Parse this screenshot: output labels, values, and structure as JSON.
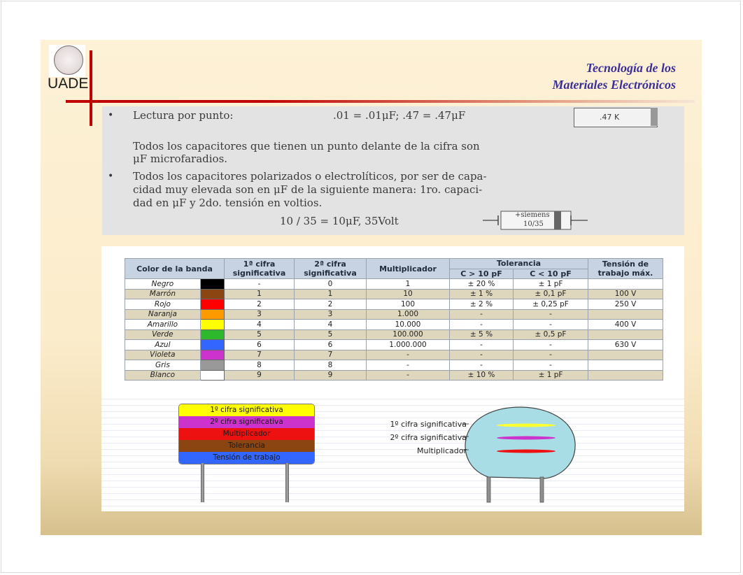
{
  "logo": {
    "text": "UADE"
  },
  "title": {
    "line1": "Tecnología de los",
    "line2": "Materiales Electrónicos"
  },
  "scan": {
    "bullet": "•",
    "lectura_label": "Lectura por punto:",
    "lectura_values": ".01 = .01μF;  .47 = .47μF",
    "cap_label": ".47 K",
    "para1_line1": "Todos los capacitores que tienen un punto delante de la cifra son",
    "para1_line2": "μF microfaradios.",
    "para2_line1": "Todos los capacitores polarizados o electrolíticos, por ser de capa-",
    "para2_line2": "cidad muy elevada son en μF de la siguiente manera: 1ro. capaci-",
    "para2_line3": "dad en μF  y 2do. tensión en voltios.",
    "example": "10 / 35  =  10μF, 35Volt",
    "elec_line1": "+siemens",
    "elec_line2": "10/35"
  },
  "table": {
    "headers": {
      "color": "Color de la banda",
      "cifra1": "1ª cifra significativa",
      "cifra2": "2ª cifra significativa",
      "mult": "Multiplicador",
      "tol": "Tolerancia",
      "tol_gt": "C > 10 pF",
      "tol_lt": "C < 10 pF",
      "tension": "Tensión de trabajo máx."
    },
    "rows": [
      {
        "name": "Negro",
        "color": "#000000",
        "d1": "-",
        "d2": "0",
        "mult": "1",
        "tgt": "± 20 %",
        "tlt": "± 1 pF",
        "v": ""
      },
      {
        "name": "Marrón",
        "color": "#8b4513",
        "d1": "1",
        "d2": "1",
        "mult": "10",
        "tgt": "± 1 %",
        "tlt": "± 0,1 pF",
        "v": "100 V"
      },
      {
        "name": "Rojo",
        "color": "#ff0000",
        "d1": "2",
        "d2": "2",
        "mult": "100",
        "tgt": "± 2 %",
        "tlt": "± 0,25 pF",
        "v": "250 V"
      },
      {
        "name": "Naranja",
        "color": "#ff9900",
        "d1": "3",
        "d2": "3",
        "mult": "1.000",
        "tgt": "-",
        "tlt": "-",
        "v": ""
      },
      {
        "name": "Amarillo",
        "color": "#ffff00",
        "d1": "4",
        "d2": "4",
        "mult": "10.000",
        "tgt": "-",
        "tlt": "-",
        "v": "400 V"
      },
      {
        "name": "Verde",
        "color": "#2db82d",
        "d1": "5",
        "d2": "5",
        "mult": "100.000",
        "tgt": "± 5 %",
        "tlt": "± 0,5 pF",
        "v": ""
      },
      {
        "name": "Azul",
        "color": "#3366ff",
        "d1": "6",
        "d2": "6",
        "mult": "1.000.000",
        "tgt": "-",
        "tlt": "-",
        "v": "630 V"
      },
      {
        "name": "Violeta",
        "color": "#cc33cc",
        "d1": "7",
        "d2": "7",
        "mult": "-",
        "tgt": "-",
        "tlt": "-",
        "v": ""
      },
      {
        "name": "Gris",
        "color": "#999999",
        "d1": "8",
        "d2": "8",
        "mult": "-",
        "tgt": "-",
        "tlt": "-",
        "v": ""
      },
      {
        "name": "Blanco",
        "color": "#ffffff",
        "d1": "9",
        "d2": "9",
        "mult": "-",
        "tgt": "± 10 %",
        "tlt": "± 1 pF",
        "v": ""
      }
    ]
  },
  "rect_cap": {
    "bands": [
      {
        "label": "1º cifra significativa",
        "color": "#ffff00"
      },
      {
        "label": "2º cifra significativa",
        "color": "#cc33cc"
      },
      {
        "label": "Multiplicador",
        "color": "#ee1111"
      },
      {
        "label": "Tolerancia",
        "color": "#8b4513"
      },
      {
        "label": "Tensión de trabajo",
        "color": "#3366ff"
      }
    ]
  },
  "disc_cap": {
    "labels": [
      "1º cifra significativa",
      "2º cifra significativa",
      "Multiplicador"
    ],
    "band_colors": [
      "#ffff33",
      "#cc33cc",
      "#ee1111"
    ]
  }
}
